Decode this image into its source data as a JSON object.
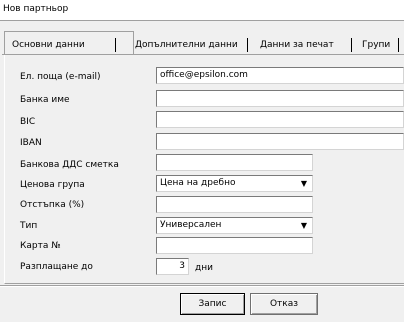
{
  "window": {
    "title": "Нов партньор"
  },
  "tabs": [
    {
      "label": "Основни данни"
    },
    {
      "label": "Допълнителни данни"
    },
    {
      "label": "Данни за печат"
    },
    {
      "label": "Групи"
    }
  ],
  "form": {
    "email": {
      "label": "Ел. поща (e-mail)",
      "value": "office@epsilon.com"
    },
    "bank_name": {
      "label": "Банка име",
      "value": ""
    },
    "bic": {
      "label": "BIC",
      "value": ""
    },
    "iban": {
      "label": "IBAN",
      "value": ""
    },
    "bank_vat_account": {
      "label": "Банкова ДДС сметка",
      "value": ""
    },
    "price_group": {
      "label": "Ценова група",
      "value": "Цена на дребно"
    },
    "discount": {
      "label": "Отстъпка (%)",
      "value": ""
    },
    "type": {
      "label": "Тип",
      "value": "Универсален"
    },
    "card_no": {
      "label": "Карта №",
      "value": ""
    },
    "payment_term": {
      "label": "Разплащане до",
      "value": "3",
      "unit": "дни"
    }
  },
  "buttons": {
    "save": "Запис",
    "cancel": "Отказ"
  }
}
